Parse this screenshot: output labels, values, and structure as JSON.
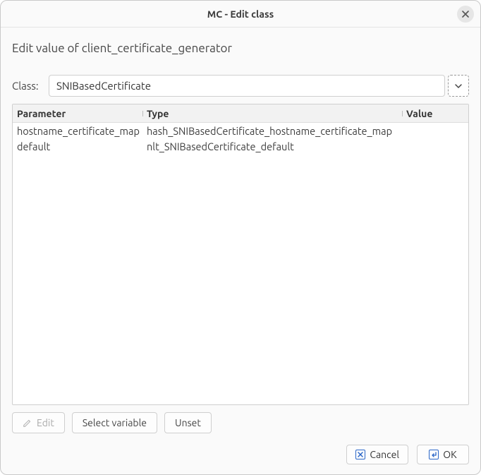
{
  "window": {
    "title": "MC - Edit class"
  },
  "heading": "Edit value of client_certificate_generator",
  "class_row": {
    "label": "Class:",
    "value": "SNIBasedCertificate"
  },
  "table": {
    "headers": {
      "parameter": "Parameter",
      "type": "Type",
      "value": "Value"
    },
    "rows": [
      {
        "parameter": "hostname_certificate_map",
        "type": "hash_SNIBasedCertificate_hostname_certificate_map",
        "value": ""
      },
      {
        "parameter": "default",
        "type": "nlt_SNIBasedCertificate_default",
        "value": ""
      }
    ]
  },
  "actions": {
    "edit": "Edit",
    "select_variable": "Select variable",
    "unset": "Unset"
  },
  "dialog": {
    "cancel": "Cancel",
    "ok": "OK"
  }
}
